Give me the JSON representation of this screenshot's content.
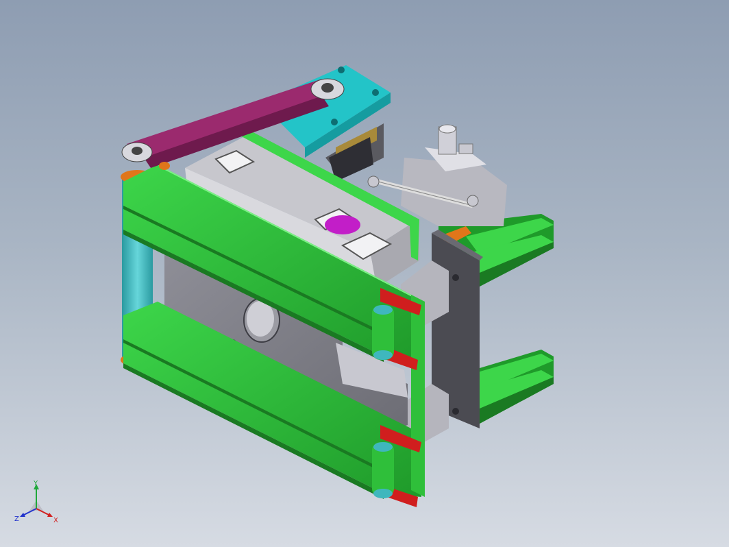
{
  "viewport": {
    "background_top": "#8e9db2",
    "background_bottom": "#d6dbe3"
  },
  "model": {
    "colors": {
      "frame_green": "#2fbf3a",
      "frame_green_dark": "#1a7a22",
      "belt": "#9b2a6e",
      "motor_plate": "#23c4c8",
      "block_light": "#d3d3d3",
      "block_gray": "#9a9aa2",
      "plate_dark": "#4b4b52",
      "clamp_red": "#d01e1e",
      "bushing_magenta": "#c21ec8",
      "rod_orange": "#e0761a",
      "roller_teal": "#3fb7bd"
    }
  },
  "triad": {
    "x_label": "X",
    "y_label": "Y",
    "z_label": "Z",
    "x_color": "#d21f1f",
    "y_color": "#1fa83a",
    "z_color": "#2233cc"
  }
}
